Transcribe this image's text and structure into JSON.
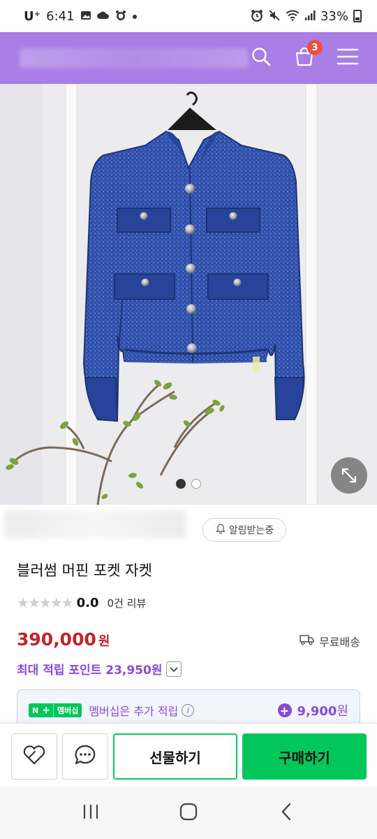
{
  "status_bar": {
    "carrier": "U⁺",
    "time": "6:41",
    "battery": "33%"
  },
  "header": {
    "cart_count": "3"
  },
  "gallery": {
    "total_images": 2,
    "active_index": 0
  },
  "product": {
    "alert_chip_label": "알림받는중",
    "title": "블러썸 머핀 포켓 자켓",
    "rating_score": "0.0",
    "review_count": "0건 리뷰",
    "price": "390,000",
    "price_unit": "원",
    "delivery_label": "무료배송",
    "points_label": "최대 적립 포인트 23,950원"
  },
  "membership": {
    "badge_n": "N",
    "badge_plus": "+",
    "badge_label": "멤버십",
    "text": "멤버십은 추가 적립",
    "amount": "9,900",
    "amount_unit": "원"
  },
  "actions": {
    "gift_label": "선물하기",
    "buy_label": "구매하기"
  },
  "colors": {
    "header_bg": "#a97ee6",
    "price": "#c4232b",
    "accent_purple": "#8a4ad9",
    "buy_green": "#03c75a"
  }
}
